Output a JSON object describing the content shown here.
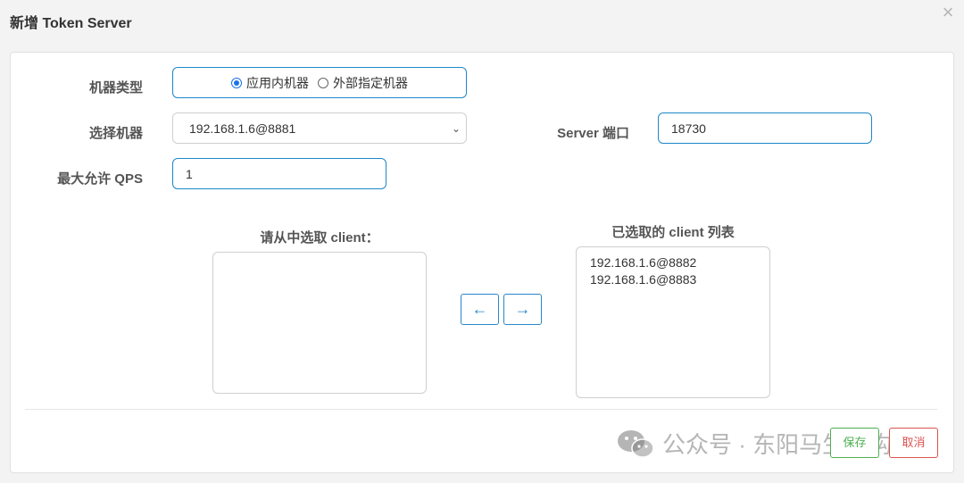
{
  "dialog": {
    "title": "新增 Token Server",
    "close_icon": "×"
  },
  "form": {
    "machine_type": {
      "label": "机器类型",
      "options": [
        {
          "label": "应用内机器",
          "checked": true
        },
        {
          "label": "外部指定机器",
          "checked": false
        }
      ]
    },
    "select_machine": {
      "label": "选择机器",
      "value": "192.168.1.6@8881"
    },
    "server_port": {
      "label": "Server 端口",
      "value": "18730"
    },
    "max_qps": {
      "label": "最大允许 QPS",
      "value": "1"
    }
  },
  "clients": {
    "available_title": "请从中选取 client：",
    "available": [],
    "selected_title": "已选取的 client 列表",
    "selected": [
      "192.168.1.6@8882",
      "192.168.1.6@8883"
    ],
    "move_left": "←",
    "move_right": "→"
  },
  "footer": {
    "save_label": "保存",
    "cancel_label": "取消"
  },
  "watermark": {
    "text": "公众号 · 东阳马生架构"
  },
  "colors": {
    "accent": "#1e88c8",
    "save": "#4caf50",
    "cancel": "#d9534f"
  }
}
